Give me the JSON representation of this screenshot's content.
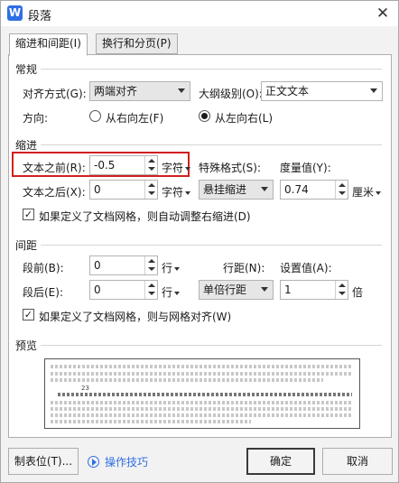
{
  "window": {
    "title": "段落",
    "app_icon": "W"
  },
  "tabs": [
    {
      "label": "缩进和间距(I)",
      "active": true
    },
    {
      "label": "换行和分页(P)",
      "active": false
    }
  ],
  "general": {
    "section": "常规",
    "align_label": "对齐方式(G):",
    "align_value": "两端对齐",
    "outline_label": "大纲级别(O):",
    "outline_value": "正文文本",
    "direction_label": "方向:",
    "rtl_label": "从右向左(F)",
    "ltr_label": "从左向右(L)",
    "direction_selected": "ltr"
  },
  "indent": {
    "section": "缩进",
    "before_label": "文本之前(R):",
    "before_value": "-0.5",
    "before_unit": "字符",
    "after_label": "文本之后(X):",
    "after_value": "0",
    "after_unit": "字符",
    "special_label": "特殊格式(S):",
    "special_value": "悬挂缩进",
    "measure_label": "度量值(Y):",
    "measure_value": "0.74",
    "measure_unit": "厘米",
    "grid_check_label": "如果定义了文档网格，则自动调整右缩进(D)",
    "grid_checked": true
  },
  "spacing": {
    "section": "间距",
    "before_label": "段前(B):",
    "before_value": "0",
    "before_unit": "行",
    "after_label": "段后(E):",
    "after_value": "0",
    "after_unit": "行",
    "line_label": "行距(N):",
    "line_value": "单倍行距",
    "set_label": "设置值(A):",
    "set_value": "1",
    "set_unit": "倍",
    "grid_check_label": "如果定义了文档网格，则与网格对齐(W)",
    "grid_checked": true
  },
  "preview": {
    "section": "预览",
    "sample_number": "23"
  },
  "footer": {
    "tabstop_label": "制表位(T)...",
    "tips_label": "操作技巧",
    "ok_label": "确定",
    "cancel_label": "取消"
  },
  "colors": {
    "highlight": "#d21f1f",
    "link": "#2f6fe4"
  }
}
